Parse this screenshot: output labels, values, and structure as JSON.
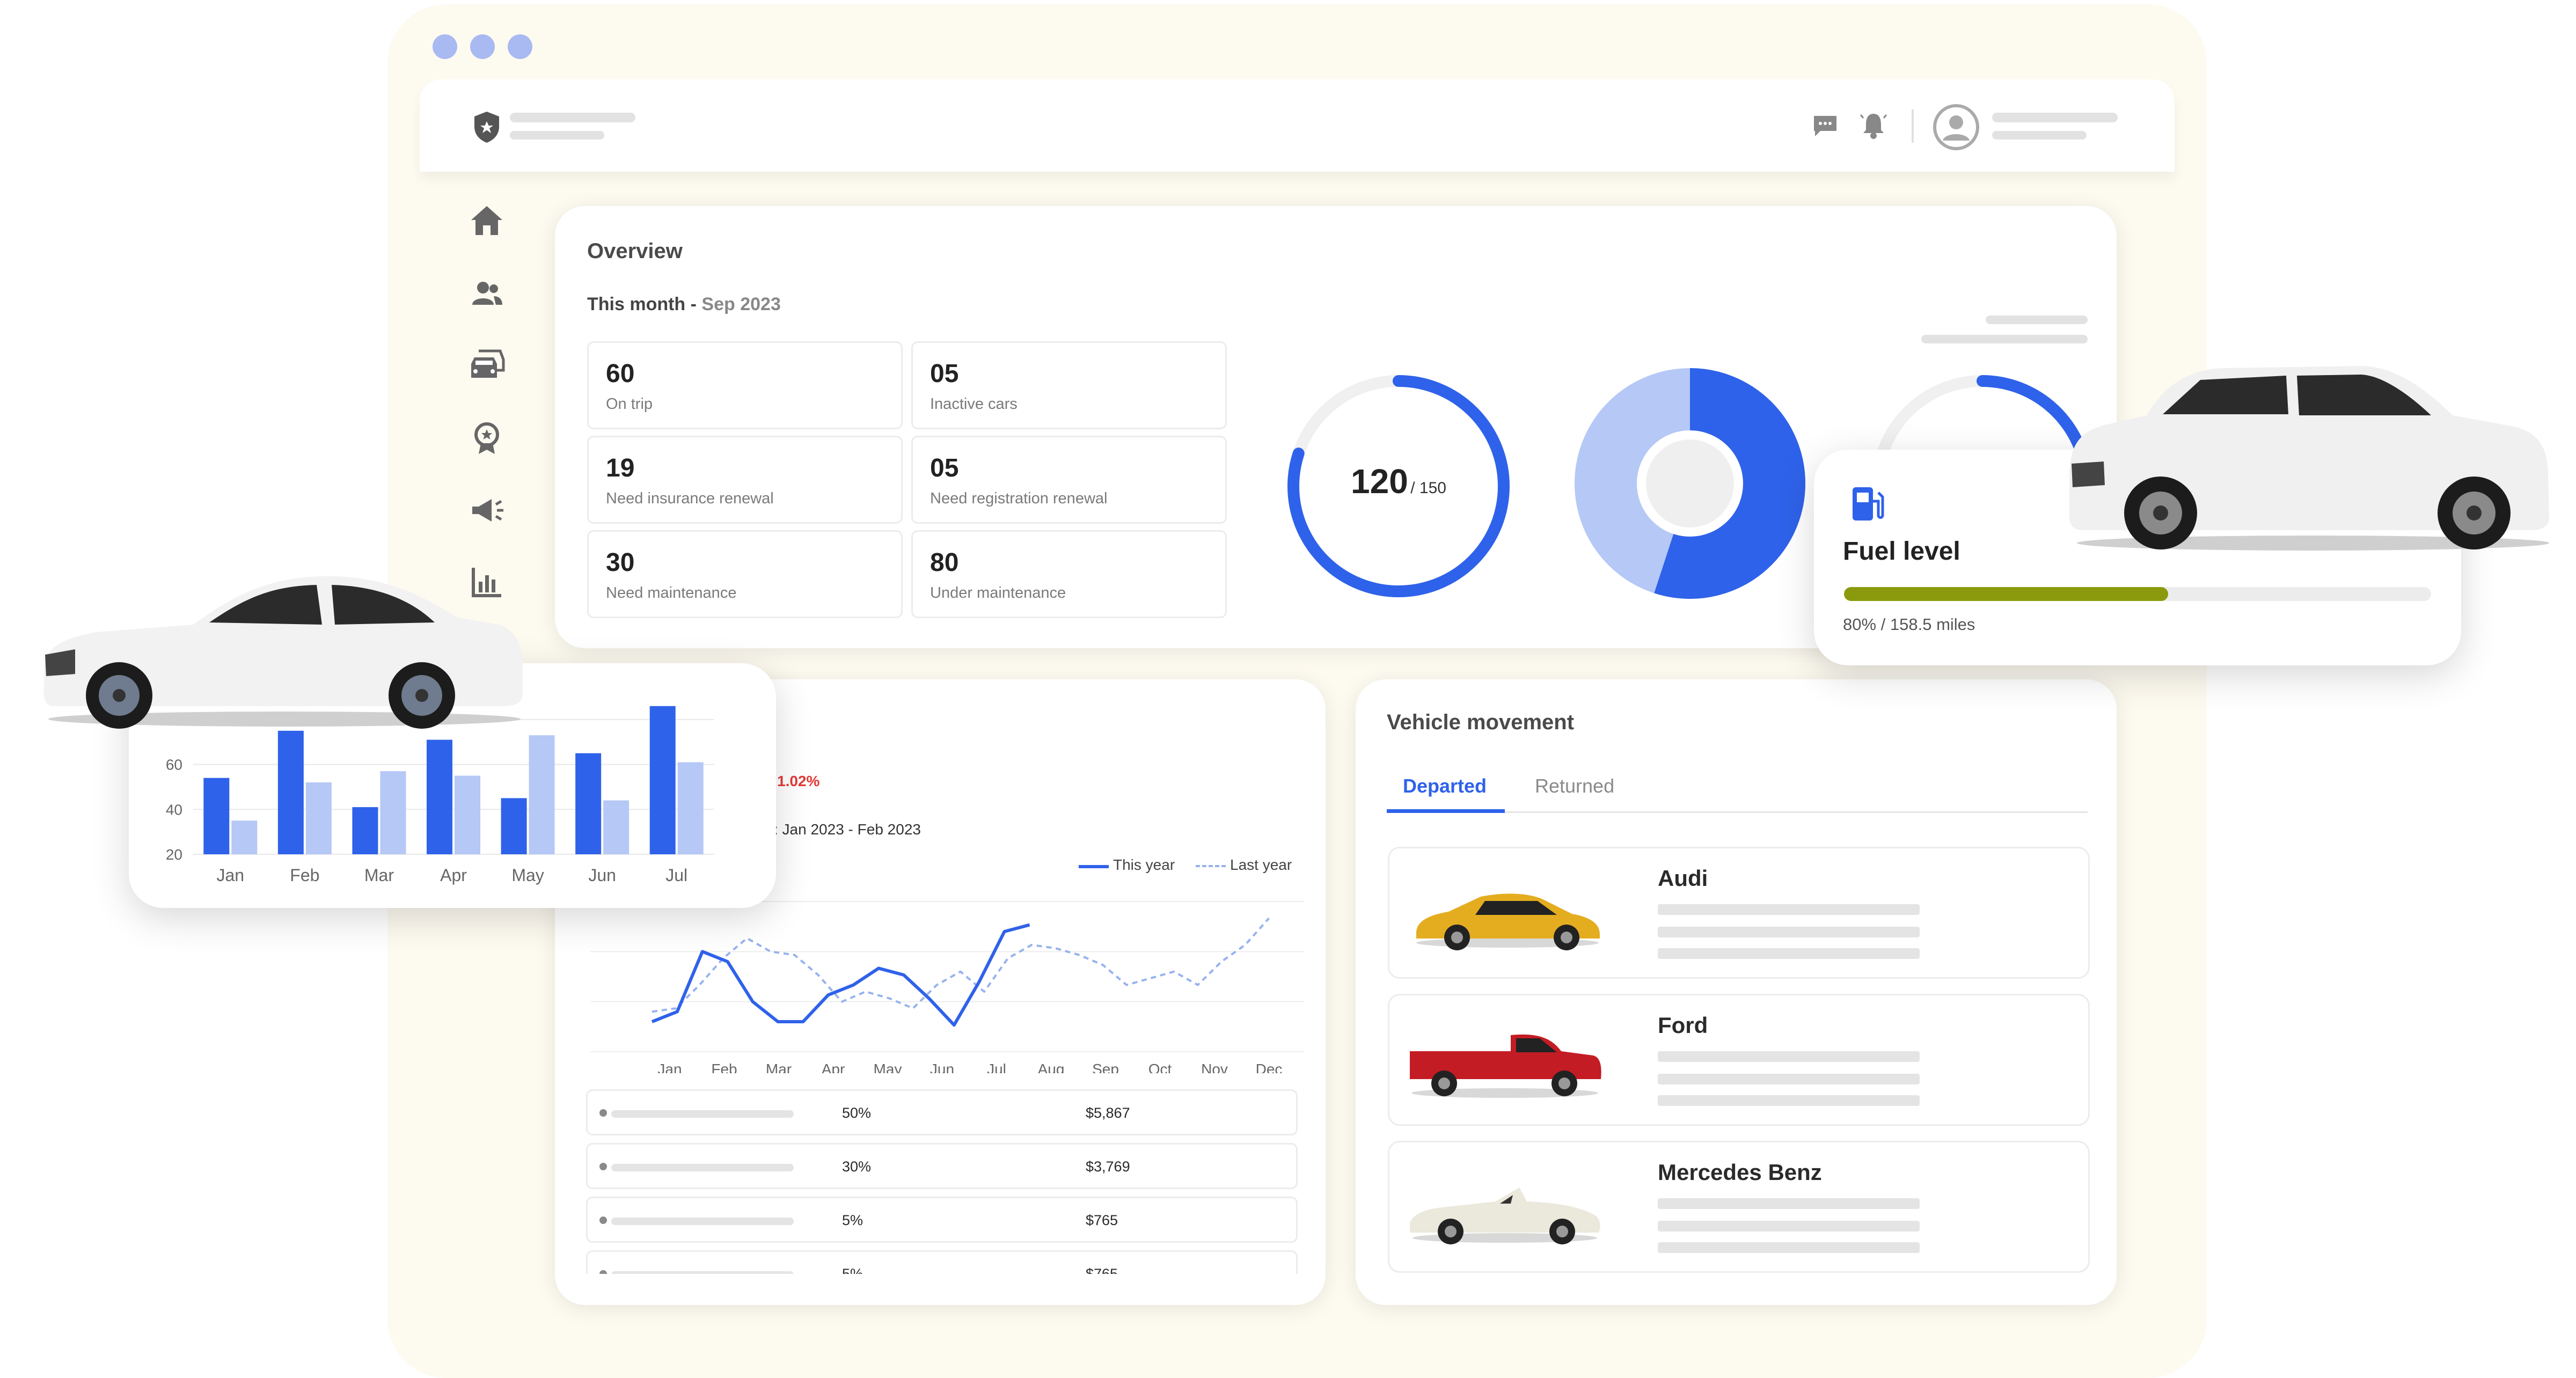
{
  "overview": {
    "title": "Overview",
    "period_label": "This month - ",
    "period_value": "Sep 2023",
    "stats": [
      {
        "value": "60",
        "label": "On trip"
      },
      {
        "value": "05",
        "label": "Inactive cars"
      },
      {
        "value": "19",
        "label": "Need insurance renewal"
      },
      {
        "value": "05",
        "label": "Need registration renewal"
      },
      {
        "value": "30",
        "label": "Need maintenance"
      },
      {
        "value": "80",
        "label": "Under maintenance"
      }
    ],
    "gauge": {
      "value": "120",
      "total": "/ 150",
      "fraction": 0.8
    },
    "donut": {
      "fraction": 0.55
    },
    "colors": {
      "accent": "#2f62ea",
      "accent_light": "#b5c8f6"
    }
  },
  "fuel": {
    "title": "Fuel level",
    "info": "80% / 158.5 miles",
    "fraction": 0.8,
    "color": "#8a9a0c"
  },
  "trend": {
    "change": "1.02%",
    "range": ": Jan 2023 - Feb 2023",
    "legend_this": "This year",
    "legend_last": "Last year",
    "rows": [
      {
        "pct": "50%",
        "amount": "$5,867"
      },
      {
        "pct": "30%",
        "amount": "$3,769"
      },
      {
        "pct": "5%",
        "amount": "$765"
      },
      {
        "pct": "5%",
        "amount": "$765"
      }
    ]
  },
  "movement": {
    "title": "Vehicle movement",
    "tabs": [
      "Departed",
      "Returned"
    ],
    "vehicles": [
      {
        "name": "Audi"
      },
      {
        "name": "Ford"
      },
      {
        "name": "Mercedes Benz"
      }
    ]
  },
  "chart_data": [
    {
      "type": "bar",
      "categories": [
        "Jan",
        "Feb",
        "Mar",
        "Apr",
        "May",
        "Jun",
        "Jul"
      ],
      "series": [
        {
          "values": [
            54,
            75,
            41,
            71,
            45,
            65,
            86
          ]
        },
        {
          "values": [
            35,
            52,
            57,
            55,
            73,
            44,
            61
          ]
        }
      ],
      "yticks": [
        20,
        40,
        60,
        80
      ],
      "ylim": [
        20,
        85
      ],
      "colors": [
        "#2f62ea",
        "#b5c8f6"
      ],
      "grid": true
    },
    {
      "type": "line",
      "categories": [
        "Jan",
        "Feb",
        "Mar",
        "Apr",
        "May",
        "Jun",
        "Jul",
        "Aug",
        "Sep",
        "Oct",
        "Nov",
        "Dec"
      ],
      "series": [
        {
          "name": "This year",
          "values": [
            9,
            12,
            30,
            27,
            15,
            9,
            9,
            17,
            20,
            25,
            23,
            16,
            8,
            21,
            36,
            38
          ]
        },
        {
          "name": "Last year",
          "values": [
            12,
            13,
            20,
            28,
            34,
            30,
            29,
            23,
            15,
            18,
            16,
            13,
            20,
            24,
            18,
            28,
            32,
            31,
            29,
            26,
            20,
            22,
            24,
            20,
            27,
            32,
            40
          ]
        }
      ],
      "ylim": [
        0,
        45
      ],
      "colors": [
        "#2f62ea",
        "#97b2ee"
      ],
      "grid": true
    }
  ]
}
